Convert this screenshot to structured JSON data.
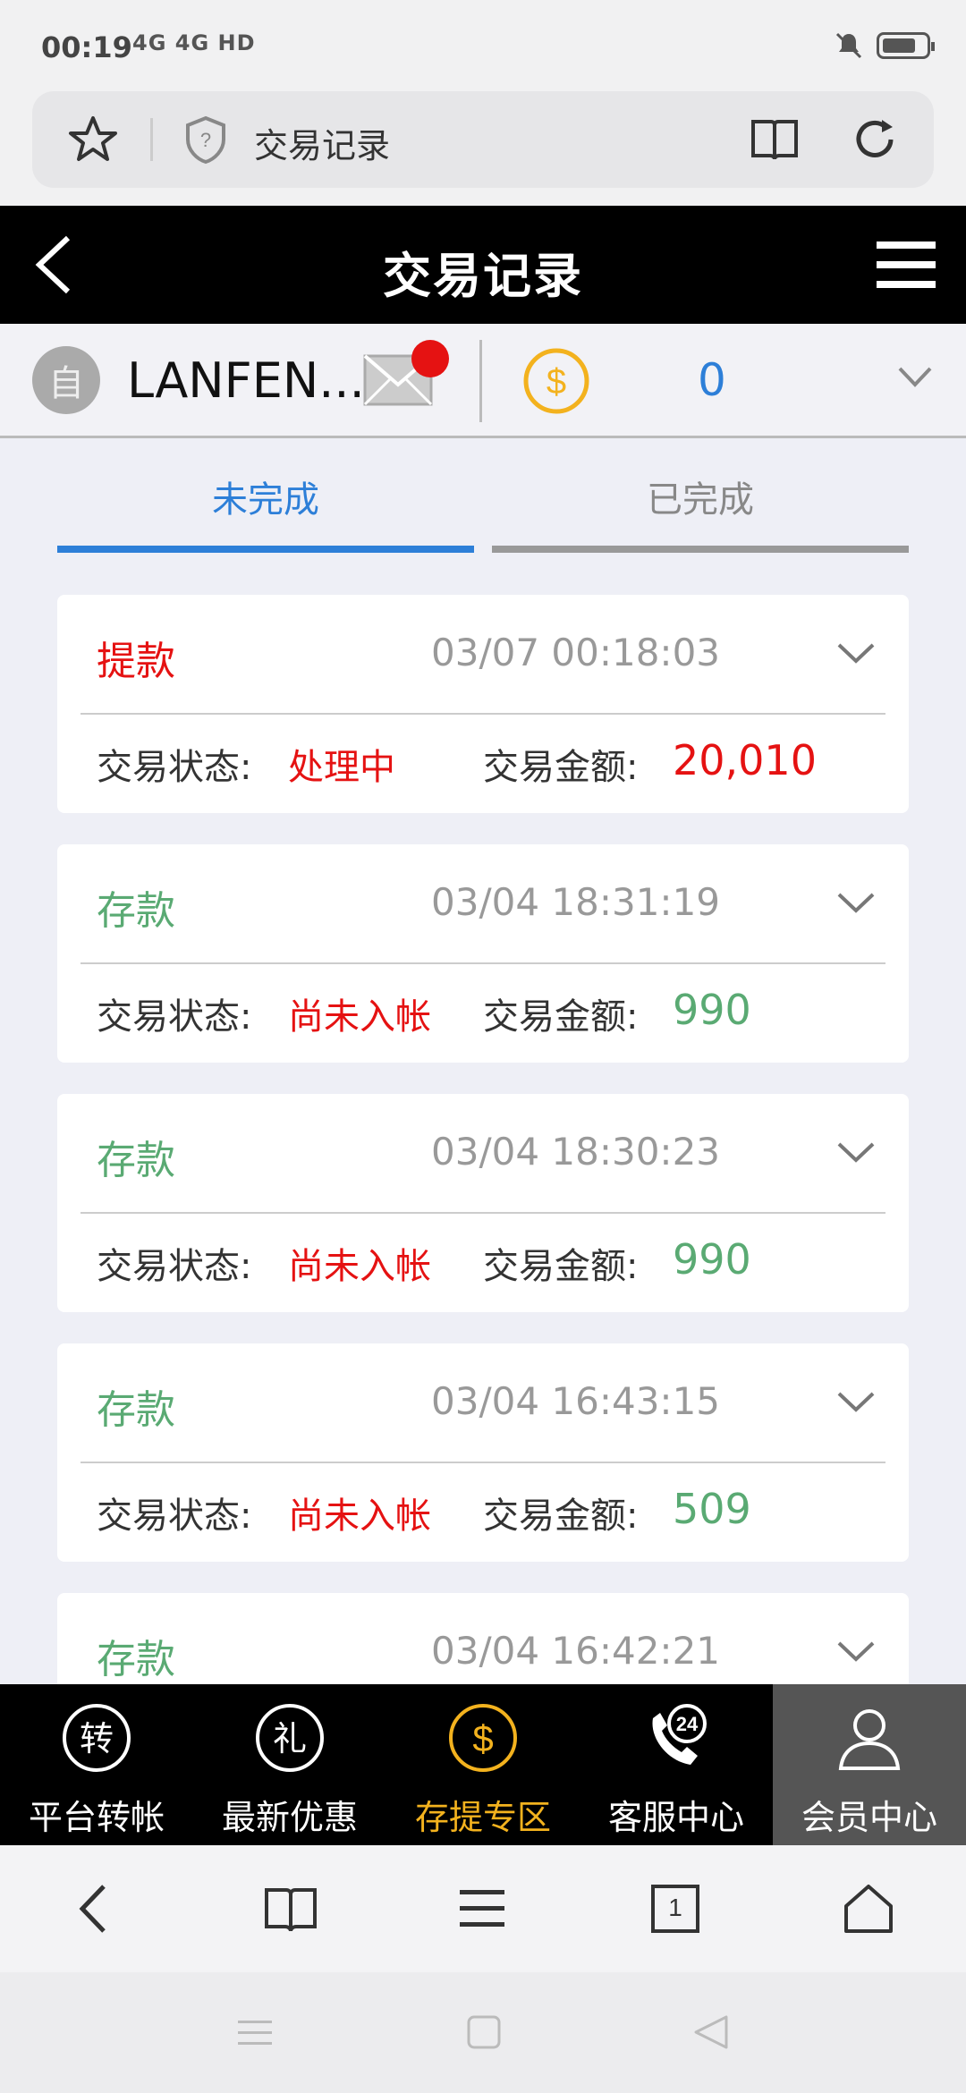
{
  "status_bar": {
    "time": "00:19",
    "network": "4G 4G HD"
  },
  "browser": {
    "url_title": "交易记录"
  },
  "header": {
    "title": "交易记录"
  },
  "user": {
    "avatar_char": "自",
    "name": "LANFEN...",
    "balance": "0"
  },
  "tabs": [
    {
      "label": "未完成",
      "active": true
    },
    {
      "label": "已完成",
      "active": false
    }
  ],
  "transactions": [
    {
      "type": "提款",
      "date": "03/07 00:18:03",
      "status_label": "交易状态:",
      "status": "处理中",
      "amount_label": "交易金额:",
      "amount": "20,010",
      "kind": "withdraw"
    },
    {
      "type": "存款",
      "date": "03/04 18:31:19",
      "status_label": "交易状态:",
      "status": "尚未入帐",
      "amount_label": "交易金额:",
      "amount": "990",
      "kind": "deposit"
    },
    {
      "type": "存款",
      "date": "03/04 18:30:23",
      "status_label": "交易状态:",
      "status": "尚未入帐",
      "amount_label": "交易金额:",
      "amount": "990",
      "kind": "deposit"
    },
    {
      "type": "存款",
      "date": "03/04 16:43:15",
      "status_label": "交易状态:",
      "status": "尚未入帐",
      "amount_label": "交易金额:",
      "amount": "509",
      "kind": "deposit"
    },
    {
      "type": "存款",
      "date": "03/04 16:42:21",
      "status_label": "",
      "status": "",
      "amount_label": "",
      "amount": "",
      "kind": "deposit"
    }
  ],
  "bottom_nav": [
    {
      "label": "平台转帐",
      "icon_char": "转",
      "icon": "transfer-icon"
    },
    {
      "label": "最新优惠",
      "icon_char": "礼",
      "icon": "gift-icon"
    },
    {
      "label": "存提专区",
      "icon_char": "$",
      "icon": "dollar-icon",
      "highlight": true
    },
    {
      "label": "客服中心",
      "icon_char": "24",
      "icon": "support-phone-icon"
    },
    {
      "label": "会员中心",
      "icon_char": "",
      "icon": "member-icon",
      "active": true
    }
  ],
  "browser_bottom": {
    "tab_count": "1"
  },
  "colors": {
    "accent_blue": "#2d7fd8",
    "red": "#e51212",
    "green": "#5aaa73",
    "gold": "#f3b21e"
  }
}
